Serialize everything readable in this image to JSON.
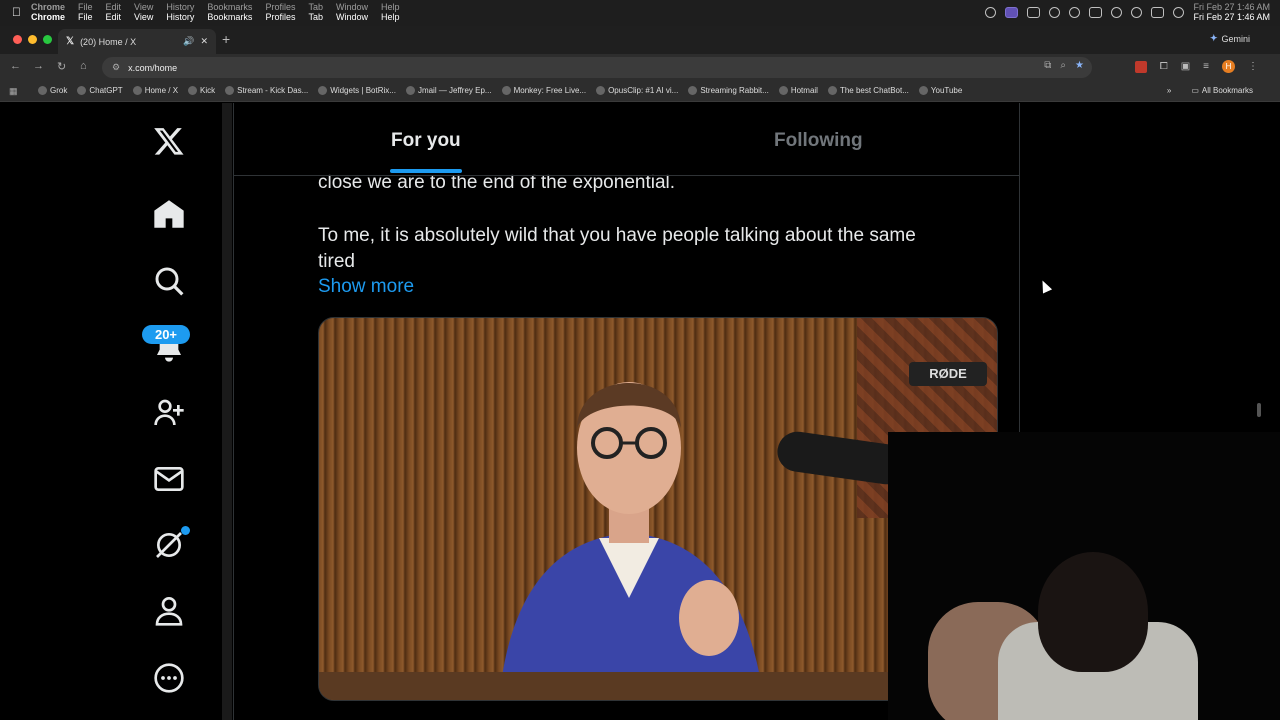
{
  "os_menubar": {
    "app": "Chrome",
    "menus": [
      "File",
      "Edit",
      "View",
      "History",
      "Bookmarks",
      "Profiles",
      "Tab",
      "Window",
      "Help"
    ],
    "clock": "Fri Feb 27  1:46 AM"
  },
  "browser": {
    "tab_title": "(20) Home / X",
    "new_tab": "+",
    "gemini_label": "Gemini",
    "url": "x.com/home",
    "profile_initial": "H",
    "bookmarks": [
      {
        "label": "Grok",
        "icon": "grok-icon"
      },
      {
        "label": "ChatGPT",
        "icon": "chatgpt-icon"
      },
      {
        "label": "Home / X",
        "icon": "x-icon"
      },
      {
        "label": "Kick",
        "icon": "kick-icon"
      },
      {
        "label": "Stream - Kick Das...",
        "icon": "kick-icon"
      },
      {
        "label": "Widgets | BotRix...",
        "icon": "botrix-icon"
      },
      {
        "label": "Jmail — Jeffrey Ep...",
        "icon": "gmail-icon"
      },
      {
        "label": "Monkey: Free Live...",
        "icon": "monkey-icon"
      },
      {
        "label": "OpusClip: #1 AI vi...",
        "icon": "opusclip-icon"
      },
      {
        "label": "Streaming Rabbit...",
        "icon": "folder-icon"
      },
      {
        "label": "Hotmail",
        "icon": "outlook-icon"
      },
      {
        "label": "The best ChatBot...",
        "icon": "chatbot-icon"
      },
      {
        "label": "YouTube",
        "icon": "youtube-icon"
      }
    ],
    "more_bookmarks": "»",
    "all_bookmarks": "All Bookmarks"
  },
  "x_nav": {
    "notifications_badge": "20+"
  },
  "feed": {
    "tabs": [
      "For you",
      "Following"
    ],
    "post_line_1": "close we are to the end of the exponential.",
    "post_line_2": "To me, it is absolutely wild that you have people talking about the same",
    "post_line_3": "tired",
    "show_more": "Show more",
    "media_mic_label": "RØDE"
  },
  "colors": {
    "accent": "#1d9bf0",
    "background": "#000000",
    "text_primary": "#e7e9ea",
    "text_secondary": "#71767b"
  }
}
